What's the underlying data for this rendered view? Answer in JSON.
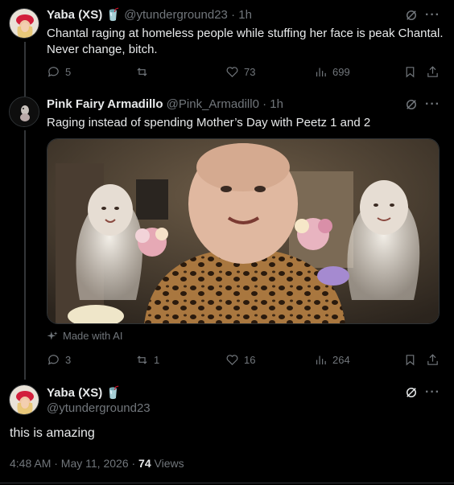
{
  "tweets": [
    {
      "name": "Yaba (XS)",
      "emoji": "🥤",
      "handle": "@ytunderground23",
      "time": "· 1h",
      "text1": "Chantal raging at homeless people while stuffing her face is peak Chantal.",
      "text2": "Never change, bitch.",
      "replies": "5",
      "reposts": "",
      "likes": "73",
      "views": "699"
    },
    {
      "name": "Pink Fairy Armadillo",
      "handle": "@Pink_Armadill0",
      "time": "· 1h",
      "text": "Raging instead of spending Mother’s Day with Peetz 1 and 2",
      "made_with_ai": "Made with AI",
      "replies": "3",
      "reposts": "1",
      "likes": "16",
      "views": "264"
    }
  ],
  "main_tweet": {
    "name": "Yaba (XS)",
    "emoji": "🥤",
    "handle": "@ytunderground23",
    "text": "this is amazing",
    "timestamp": "4:48 AM · May 11, 2026 · ",
    "views_count": "74",
    "views_label": " Views"
  },
  "icons": [
    "grok-icon",
    "more-icon",
    "reply-icon",
    "repost-icon",
    "like-icon",
    "views-icon",
    "bookmark-icon",
    "share-icon",
    "sparkle-icon"
  ]
}
